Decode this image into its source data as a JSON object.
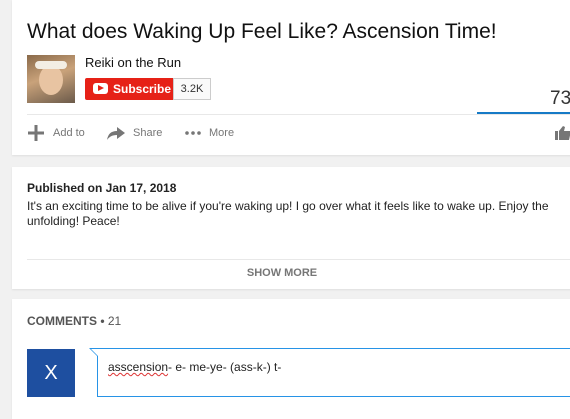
{
  "video": {
    "title": "What does Waking Up Feel Like? Ascension Time!",
    "views_partial": "73"
  },
  "channel": {
    "name": "Reiki on the Run",
    "subscribe_label": "Subscribe",
    "subscriber_count": "3.2K"
  },
  "actions": {
    "add_to": "Add to",
    "share": "Share",
    "more": "More"
  },
  "description": {
    "published": "Published on Jan 17, 2018",
    "text": "It's an exciting time to be alive if you're waking up! I go over what it feels like to wake up. Enjoy the unfolding! Peace!",
    "show_more": "SHOW MORE"
  },
  "comments": {
    "heading": "COMMENTS",
    "count": "21",
    "user_initial": "X",
    "draft_misspelled": "asscension",
    "draft_rest": "- e- me-ye- (ass-k-) t-"
  },
  "colors": {
    "subscribe_red": "#e62117",
    "accent_blue": "#167ac6",
    "avatar_blue": "#1e4fa0"
  },
  "icons": [
    "plus-icon",
    "share-arrow-icon",
    "more-dots-icon",
    "like-icon",
    "youtube-logo-icon"
  ]
}
